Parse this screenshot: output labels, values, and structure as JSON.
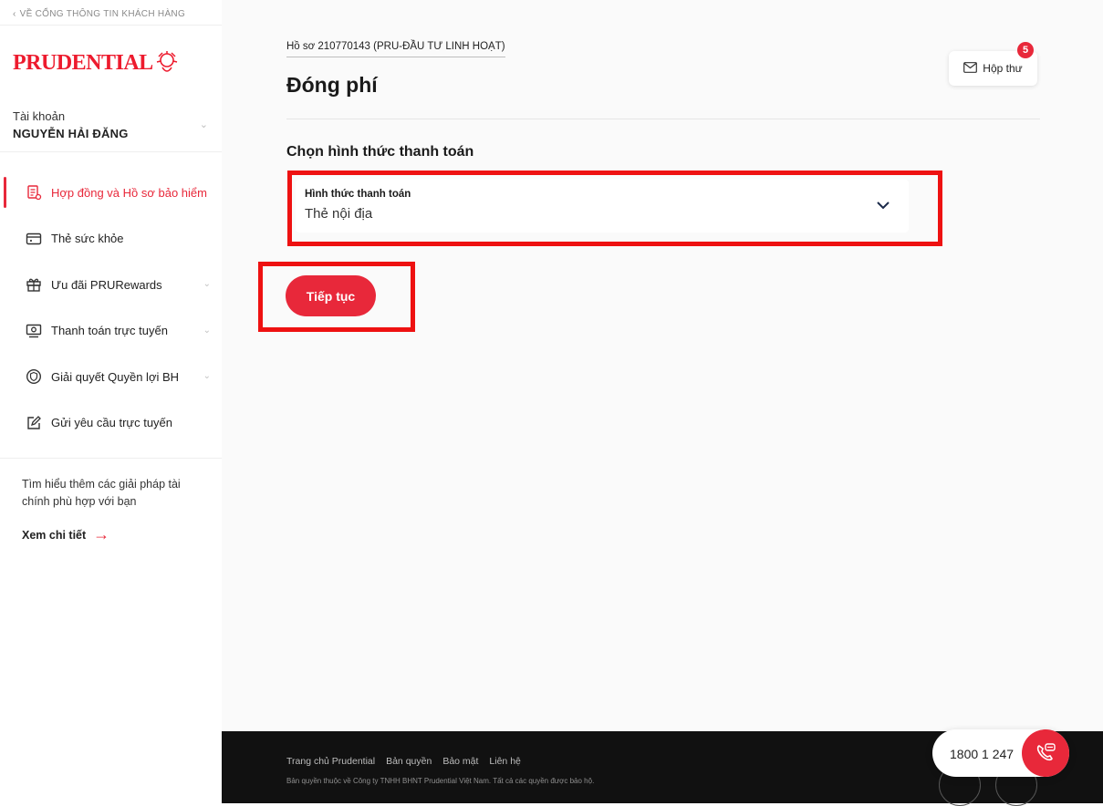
{
  "sidebar": {
    "back_link": "VỀ CỔNG THÔNG TIN KHÁCH HÀNG",
    "logo_text": "PRUDENTIAL",
    "account": {
      "label": "Tài khoản",
      "name": "NGUYỄN HẢI ĐĂNG"
    },
    "nav": [
      {
        "label": "Hợp đồng và Hồ sơ bảo hiểm",
        "icon": "document-icon",
        "active": true
      },
      {
        "label": "Thẻ sức khỏe",
        "icon": "card-icon"
      },
      {
        "label": "Ưu đãi PRURewards",
        "icon": "gift-icon"
      },
      {
        "label": "Thanh toán trực tuyến",
        "icon": "payment-icon"
      },
      {
        "label": "Giải quyết Quyền lợi BH",
        "icon": "shield-icon"
      },
      {
        "label": "Gửi yêu cầu trực tuyến",
        "icon": "edit-icon"
      }
    ],
    "promo_text": "Tìm hiểu thêm các giải pháp tài chính phù hợp với bạn",
    "promo_link": "Xem chi tiết"
  },
  "main": {
    "policy": "Hồ sơ 210770143 (PRU-ĐẦU TƯ LINH HOẠT)",
    "title": "Đóng phí",
    "inbox": {
      "label": "Hộp thư",
      "badge": "5"
    },
    "section_title": "Chọn hình thức thanh toán",
    "select": {
      "label": "Hình thức thanh toán",
      "value": "Thẻ nội địa"
    },
    "continue_button": "Tiếp tục"
  },
  "footer": {
    "links": [
      "Trang chủ Prudential",
      "Bản quyền",
      "Bảo mật",
      "Liên hệ"
    ],
    "copyright": "Bản quyền thuộc về Công ty TNHH BHNT Prudential Việt Nam. Tất cả các quyền được bảo hộ."
  },
  "hotline": "1800 1 247",
  "colors": {
    "brand": "#e8283a",
    "highlight": "#ee1111"
  }
}
